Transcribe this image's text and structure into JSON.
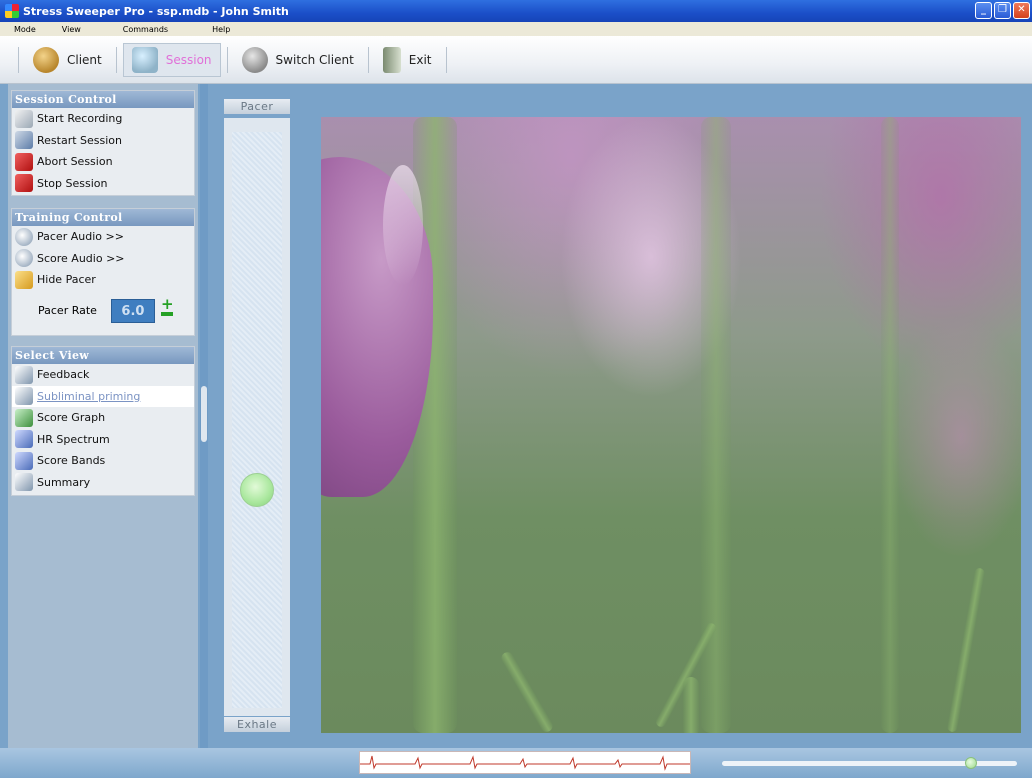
{
  "window": {
    "title": "Stress Sweeper Pro - ssp.mdb - John Smith"
  },
  "menu": [
    "Mode",
    "View",
    "Commands",
    "Help"
  ],
  "toolbar": {
    "client_label": "Client",
    "session_label": "Session",
    "switch_client_label": "Switch Client",
    "exit_label": "Exit"
  },
  "session_control": {
    "title": "Session Control",
    "items": [
      "Start Recording",
      "Restart Session",
      "Abort Session",
      "Stop Session"
    ]
  },
  "training_control": {
    "title": "Training Control",
    "items": [
      "Pacer Audio >>",
      "Score Audio >>",
      "Hide Pacer"
    ],
    "pacer_rate_label": "Pacer Rate",
    "pacer_rate_value": "6.0"
  },
  "select_view": {
    "title": "Select View",
    "items": [
      "Feedback",
      "Subliminal priming",
      "Score Graph",
      "HR Spectrum",
      "Score Bands",
      "Summary"
    ],
    "selected": "Subliminal priming"
  },
  "pacer": {
    "top_label": "Pacer",
    "bottom_label": "Exhale",
    "level": 0.63
  },
  "status": {
    "slider_value": 0.86
  }
}
